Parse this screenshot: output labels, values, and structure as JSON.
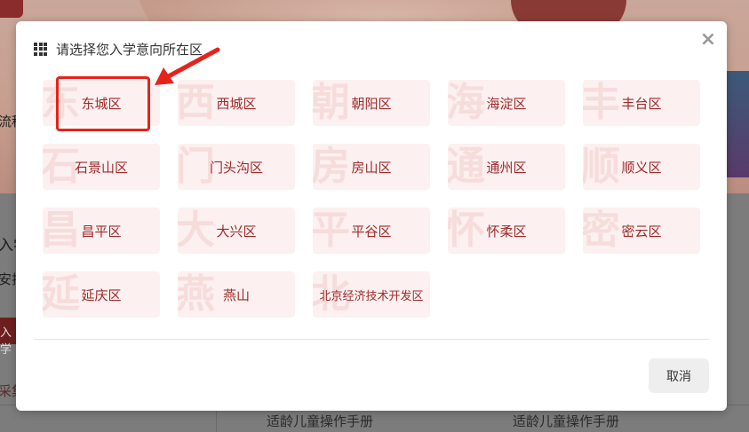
{
  "background": {
    "side_texts": [
      "流程",
      "入学",
      "安排",
      "入学",
      "采集"
    ],
    "manual_links": [
      "适龄儿童操作手册",
      "适龄儿童操作手册"
    ]
  },
  "modal": {
    "title": "请选择您入学意向所在区",
    "close_icon": "×",
    "cancel_label": "取消",
    "districts": [
      {
        "label": "东城区",
        "watermark": "东"
      },
      {
        "label": "西城区",
        "watermark": "西"
      },
      {
        "label": "朝阳区",
        "watermark": "朝"
      },
      {
        "label": "海淀区",
        "watermark": "海"
      },
      {
        "label": "丰台区",
        "watermark": "丰"
      },
      {
        "label": "石景山区",
        "watermark": "石"
      },
      {
        "label": "门头沟区",
        "watermark": "门"
      },
      {
        "label": "房山区",
        "watermark": "房"
      },
      {
        "label": "通州区",
        "watermark": "通"
      },
      {
        "label": "顺义区",
        "watermark": "顺"
      },
      {
        "label": "昌平区",
        "watermark": "昌"
      },
      {
        "label": "大兴区",
        "watermark": "大"
      },
      {
        "label": "平谷区",
        "watermark": "平"
      },
      {
        "label": "怀柔区",
        "watermark": "怀"
      },
      {
        "label": "密云区",
        "watermark": "密"
      },
      {
        "label": "延庆区",
        "watermark": "延"
      },
      {
        "label": "燕山",
        "watermark": "燕"
      },
      {
        "label": "北京经济技术开发区",
        "watermark": "北"
      }
    ]
  },
  "colors": {
    "accent": "#9e2a2a",
    "tile_bg": "#fcf0f0",
    "watermark": "#f7dcdc",
    "annotation": "#e5231b"
  }
}
